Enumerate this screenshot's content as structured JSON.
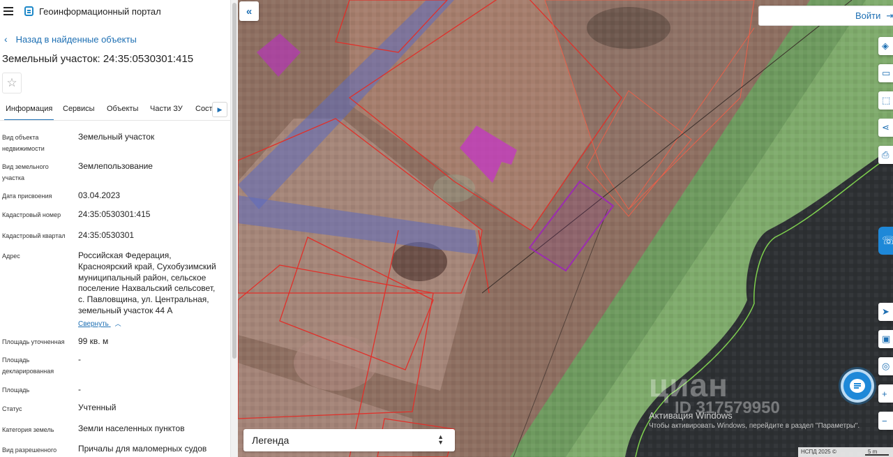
{
  "app": {
    "title": "Геоинформационный портал"
  },
  "nav": {
    "back_label": "Назад в найденные объекты"
  },
  "object": {
    "title": "Земельный участок: 24:35:0530301:415"
  },
  "tabs": [
    {
      "label": "Информация",
      "active": true
    },
    {
      "label": "Сервисы"
    },
    {
      "label": "Объекты"
    },
    {
      "label": "Части ЗУ"
    },
    {
      "label": "Соста"
    }
  ],
  "properties": [
    {
      "label": "Вид объекта недвижимости",
      "value": "Земельный участок"
    },
    {
      "label": "Вид земельного участка",
      "value": "Землепользование"
    },
    {
      "label": "Дата присвоения",
      "value": "03.04.2023"
    },
    {
      "label": "Кадастровый номер",
      "value": "24:35:0530301:415"
    },
    {
      "label": "Кадастровый квартал",
      "value": "24:35:0530301"
    },
    {
      "label": "Адрес",
      "value": "Российская Федерация, Красноярский край, Сухобузимский муниципальный район, сельское поселение Нахвальский сельсовет, с. Павловщина, ул. Центральная, земельный участок 44 А"
    },
    {
      "label": "Площадь уточненная",
      "value": "99 кв. м"
    },
    {
      "label": "Площадь декларированная",
      "value": "-"
    },
    {
      "label": "Площадь",
      "value": "-"
    },
    {
      "label": "Статус",
      "value": "Учтенный"
    },
    {
      "label": "Категория земель",
      "value": "Земли населенных пунктов"
    },
    {
      "label": "Вид разрешенного",
      "value": "Причалы для маломерных судов"
    }
  ],
  "collapse_label": "Свернуть",
  "map": {
    "login_label": "Войти",
    "legend_label": "Легенда",
    "watermark": "циан",
    "watermark_id": "ID 317579950",
    "windows_activation_title": "Активация Windows",
    "windows_activation_sub": "Чтобы активировать Windows, перейдите в раздел \"Параметры\".",
    "copyright": "НСПД 2025 ©",
    "scale": "5 m"
  },
  "icons": {
    "menu": "hamburger-icon",
    "logo": "portal-logo-icon",
    "back": "chevron-left-icon",
    "star": "star-icon",
    "tabs_next": "chevron-right-icon",
    "collapse_map": "double-chevron-left-icon",
    "login": "login-arrow-icon",
    "layers": "layers-icon",
    "ruler": "ruler-icon",
    "select": "select-area-icon",
    "share": "share-icon",
    "print": "print-icon",
    "locate": "locate-icon",
    "minimap": "minimap-icon",
    "pin": "pin-search-icon",
    "zoom_in": "plus-icon",
    "zoom_out": "minus-icon",
    "chat": "chat-icon"
  },
  "colors": {
    "accent": "#1d6fb3",
    "chat": "#1e88d8",
    "parcel_outline": "#e0302a",
    "selected_parcel": "#9b2cb0"
  }
}
